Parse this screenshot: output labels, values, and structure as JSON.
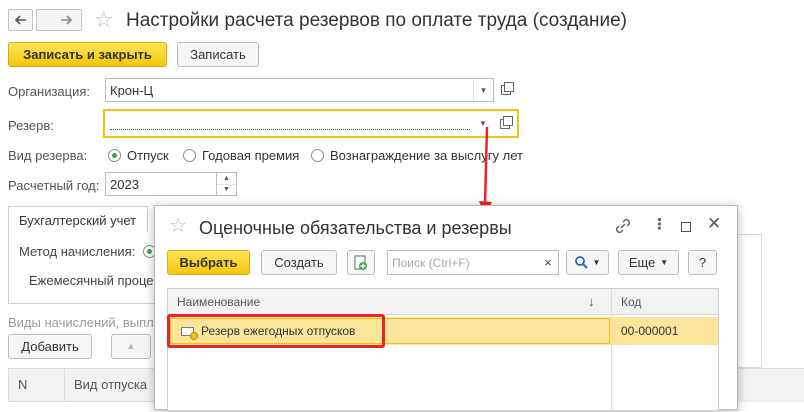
{
  "header": {
    "title": "Настройки расчета резервов по оплате труда (создание)",
    "back_icon": "arrow-left-icon",
    "forward_icon": "arrow-right-icon",
    "favorite_icon": "star-icon"
  },
  "toolbar": {
    "save_close_label": "Записать и закрыть",
    "save_label": "Записать"
  },
  "form": {
    "organization_label": "Организация:",
    "organization_value": "Крон-Ц",
    "reserve_label": "Резерв:",
    "reserve_value": "",
    "reserve_type_label": "Вид резерва:",
    "reserve_types": [
      "Отпуск",
      "Годовая премия",
      "Вознаграждение за выслугу лет"
    ],
    "reserve_type_selected": "Отпуск",
    "year_label": "Расчетный год:",
    "year_value": "2023"
  },
  "tabs": {
    "accounting_label": "Бухгалтерский учет",
    "method_label": "Метод начисления:",
    "monthly_label": "Ежемесячный проце"
  },
  "accruals": {
    "section_label": "Виды начислений, выпл",
    "add_label": "Добавить",
    "col_n": "N",
    "col_vacation_type": "Вид отпуска"
  },
  "dialog": {
    "title": "Оценочные обязательства и резервы",
    "select_label": "Выбрать",
    "create_label": "Создать",
    "search_placeholder": "Поиск (Ctrl+F)",
    "more_label": "Еще",
    "help_label": "?",
    "col_name": "Наименование",
    "col_code": "Код",
    "rows": [
      {
        "name": "Резерв ежегодных отпусков",
        "code": "00-000001"
      }
    ]
  },
  "colors": {
    "accent": "#f3c70c",
    "selection": "#fbe59a",
    "highlight_box": "#e8232b",
    "radio_on": "#3aa54b"
  }
}
